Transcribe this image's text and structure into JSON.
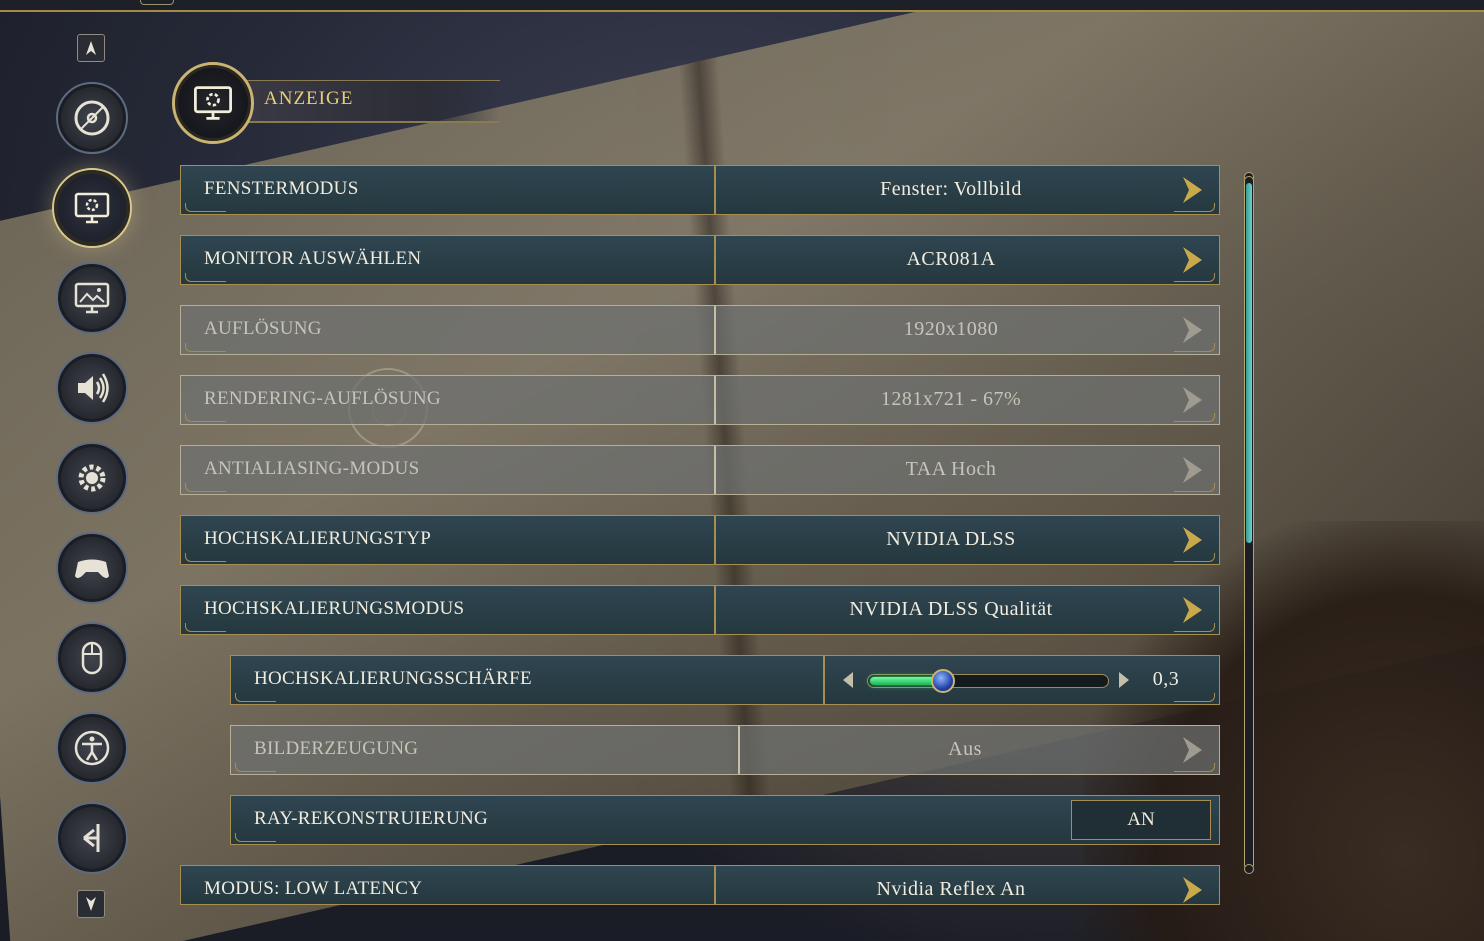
{
  "header": {
    "title": "ANZEIGE",
    "icon": "monitor-gear-icon"
  },
  "colors": {
    "accent_gold": "#c9b472",
    "row_bg": "#2f4550",
    "slider_fill": "#2ee07a",
    "scroll_thumb": "#4fb8ae"
  },
  "nav": {
    "items": [
      {
        "name": "nav-disc",
        "icon": "disc-icon"
      },
      {
        "name": "nav-display",
        "icon": "monitor-gear-icon",
        "active": true
      },
      {
        "name": "nav-graphics",
        "icon": "monitor-image-icon"
      },
      {
        "name": "nav-audio",
        "icon": "speaker-icon"
      },
      {
        "name": "nav-gameplay",
        "icon": "gear-icon"
      },
      {
        "name": "nav-controller",
        "icon": "gamepad-icon"
      },
      {
        "name": "nav-mouse",
        "icon": "mouse-icon"
      },
      {
        "name": "nav-accessibility",
        "icon": "accessibility-icon"
      },
      {
        "name": "nav-social",
        "icon": "branch-icon"
      }
    ]
  },
  "settings": [
    {
      "label": "FENSTERMODUS",
      "value": "Fenster: Vollbild",
      "enabled": true
    },
    {
      "label": "MONITOR AUSWÄHLEN",
      "value": "ACR081A",
      "enabled": true
    },
    {
      "label": "AUFLÖSUNG",
      "value": "1920x1080",
      "enabled": false
    },
    {
      "label": "RENDERING-AUFLÖSUNG",
      "value": "1281x721 - 67%",
      "enabled": false
    },
    {
      "label": "ANTIALIASING-MODUS",
      "value": "TAA Hoch",
      "enabled": false
    },
    {
      "label": "HOCHSKALIERUNGSTYP",
      "value": "NVIDIA DLSS",
      "enabled": true
    },
    {
      "label": "HOCHSKALIERUNGSMODUS",
      "value": "NVIDIA DLSS Qualität",
      "enabled": true
    },
    {
      "label": "HOCHSKALIERUNGSSCHÄRFE",
      "value": "0,3",
      "enabled": true,
      "slider_fraction": 0.3
    },
    {
      "label": "BILDERZEUGUNG",
      "value": "Aus",
      "enabled": false
    },
    {
      "label": "RAY-REKONSTRUIERUNG",
      "value": "AN",
      "enabled": true
    },
    {
      "label": "MODUS: LOW LATENCY",
      "value": "Nvidia Reflex An",
      "enabled": true
    }
  ],
  "scrollbar": {
    "thumb_fraction": 0.53
  }
}
